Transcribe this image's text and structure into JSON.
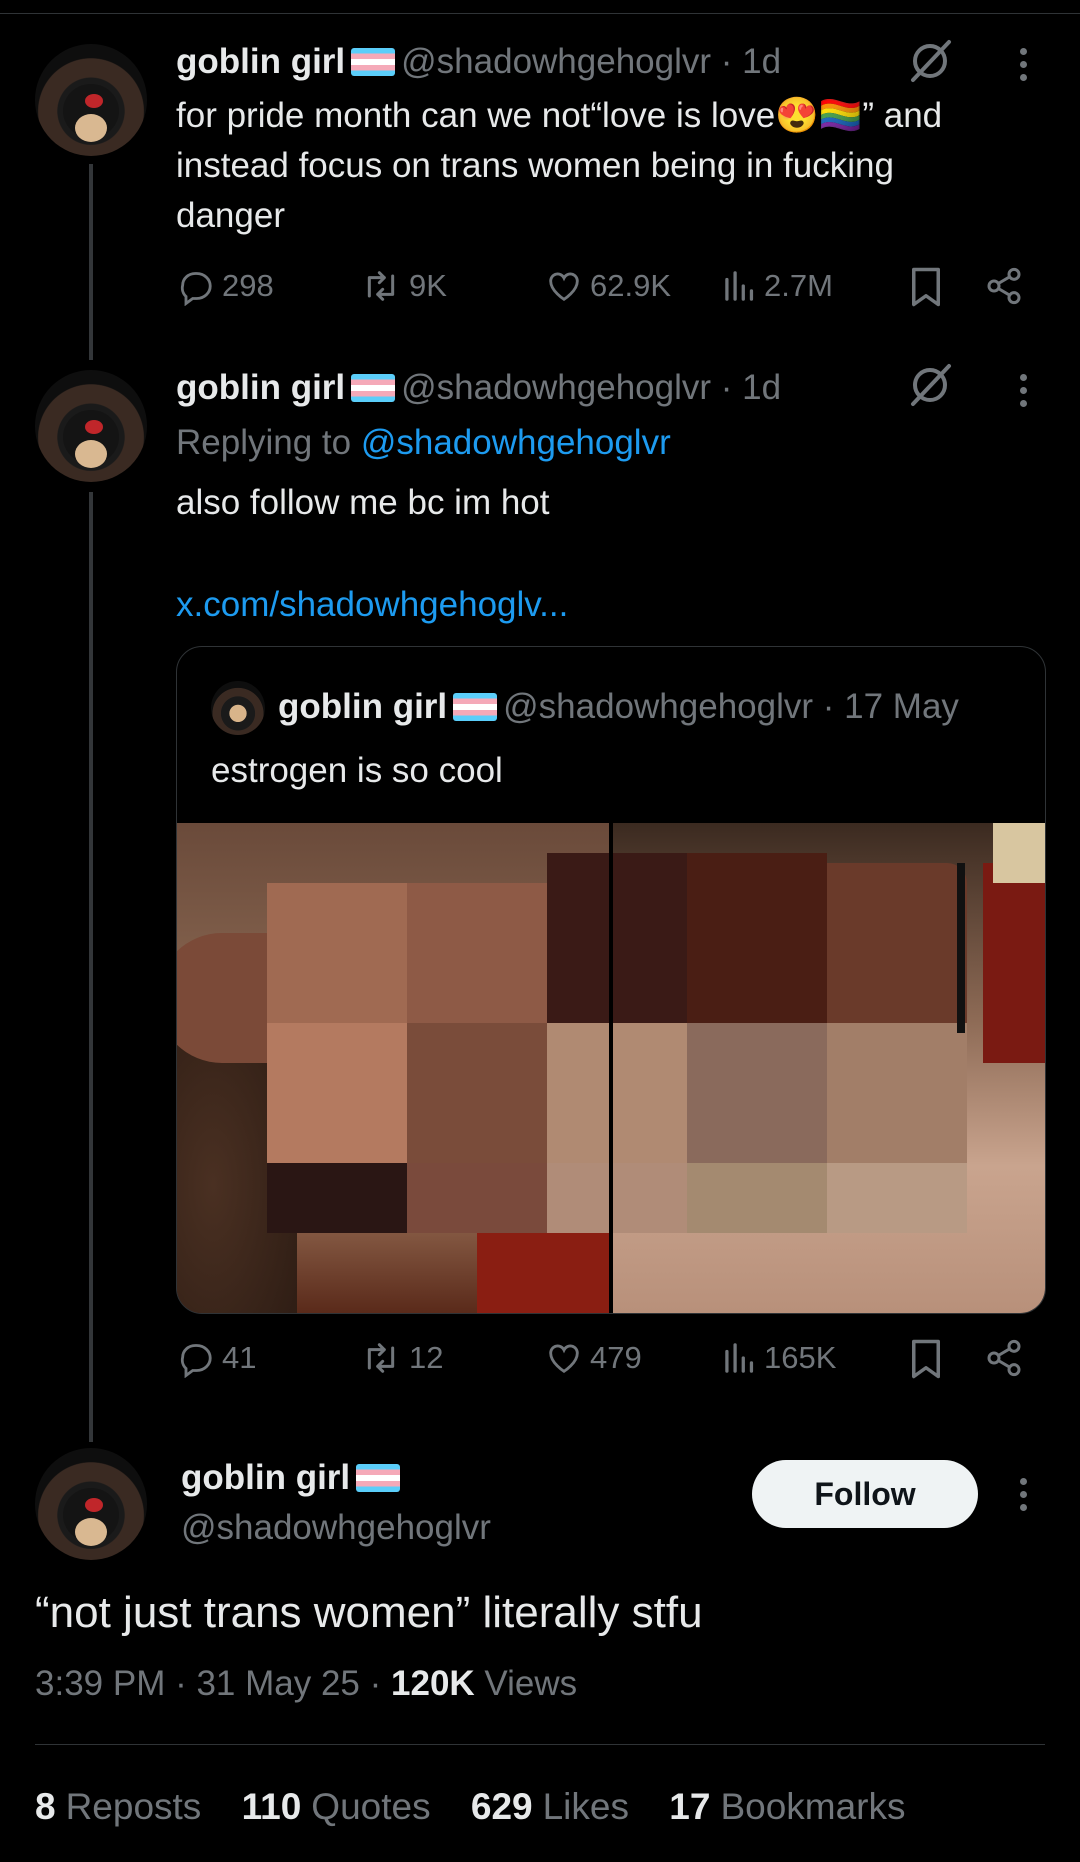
{
  "post1": {
    "name": "goblin girl",
    "handle": "@shadowhgehoglvr",
    "time": "· 1d",
    "line1_a": "for pride month can we not“love is love",
    "line1_b": "” and",
    "line2": "instead focus on trans women being in fucking",
    "line3": "danger",
    "emoji1": "😍",
    "emoji2": "🏳️‍🌈",
    "replies": "298",
    "reposts": "9K",
    "likes": "62.9K",
    "views": "2.7M"
  },
  "post2": {
    "name": "goblin girl",
    "handle": "@shadowhgehoglvr",
    "time": "· 1d",
    "replying_prefix": "Replying to",
    "replying_handle": "@shadowhgehoglvr",
    "text": "also follow me bc im hot",
    "link": "x.com/shadowhgehoglv...",
    "replies": "41",
    "reposts": "12",
    "likes": "479",
    "views": "165K"
  },
  "quote": {
    "name": "goblin girl",
    "handle": "@shadowhgehoglvr",
    "time": "· 17 May",
    "text": "estrogen is so cool"
  },
  "main": {
    "name": "goblin girl",
    "handle": "@shadowhgehoglvr",
    "follow_label": "Follow",
    "text": "“not just trans women” literally stfu",
    "time": "3:39 PM",
    "date": "31 May 25",
    "views_count": "120K",
    "views_label": "Views",
    "reposts_count": "8",
    "reposts_label": "Reposts",
    "quotes_count": "110",
    "quotes_label": "Quotes",
    "likes_count": "629",
    "likes_label": "Likes",
    "bookmarks_count": "17",
    "bookmarks_label": "Bookmarks"
  },
  "icons": [
    "reply-icon",
    "repost-icon",
    "like-icon",
    "views-icon",
    "bookmark-icon",
    "share-icon",
    "grok-icon",
    "more-icon"
  ],
  "colors": {
    "background": "#000000",
    "text": "#e7e9ea",
    "muted": "#71767b",
    "link": "#1d9bf0",
    "follow_bg": "#eff3f4"
  }
}
